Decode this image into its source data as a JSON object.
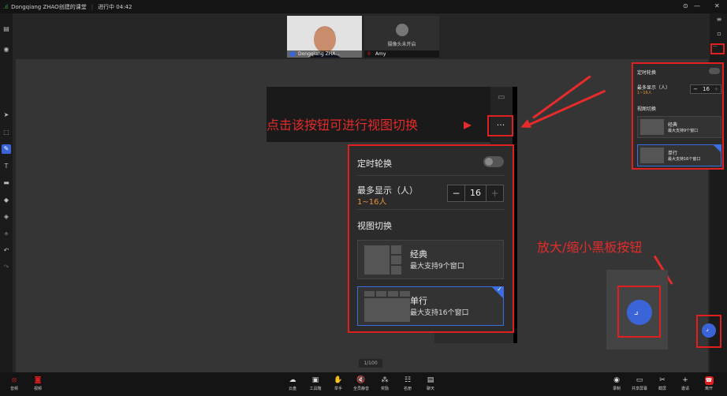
{
  "titlebar": {
    "title": "Dongqiang ZHAO创建的课堂",
    "status": "进行中 04:42"
  },
  "videos": [
    {
      "name": "Dongqiang ZHA..."
    },
    {
      "name": "Amy",
      "camera_off": "摄像头未开启"
    }
  ],
  "panel": {
    "rotate_label": "定时轮换",
    "max_label": "最多显示（人）",
    "max_range": "1~16人",
    "max_value": "16",
    "minus": "−",
    "plus": "+",
    "view_label": "视图切换",
    "options": [
      {
        "title": "经典",
        "desc": "最大支持9个窗口"
      },
      {
        "title": "单行",
        "desc": "最大支持16个窗口"
      }
    ]
  },
  "annotations": {
    "switch_hint": "点击该按钮可进行视图切换",
    "zoom_hint": "放大/缩小黑板按钮"
  },
  "page_indicator": "1/100",
  "more_button": "···",
  "bottombar": {
    "left": [
      {
        "label": "音频"
      },
      {
        "label": "视频"
      }
    ],
    "center": [
      {
        "label": "云盘"
      },
      {
        "label": "工具箱"
      },
      {
        "label": "举手"
      },
      {
        "label": "全员静音"
      },
      {
        "label": "奖励"
      },
      {
        "label": "名册"
      },
      {
        "label": "聊天"
      }
    ],
    "right": [
      {
        "label": "录制"
      },
      {
        "label": "共享屏幕"
      },
      {
        "label": "截屏"
      },
      {
        "label": "邀请"
      },
      {
        "label": "离开"
      }
    ]
  },
  "colors": {
    "accent": "#3b6fe0",
    "annotation": "#e52b2b",
    "range": "#e8913a"
  }
}
